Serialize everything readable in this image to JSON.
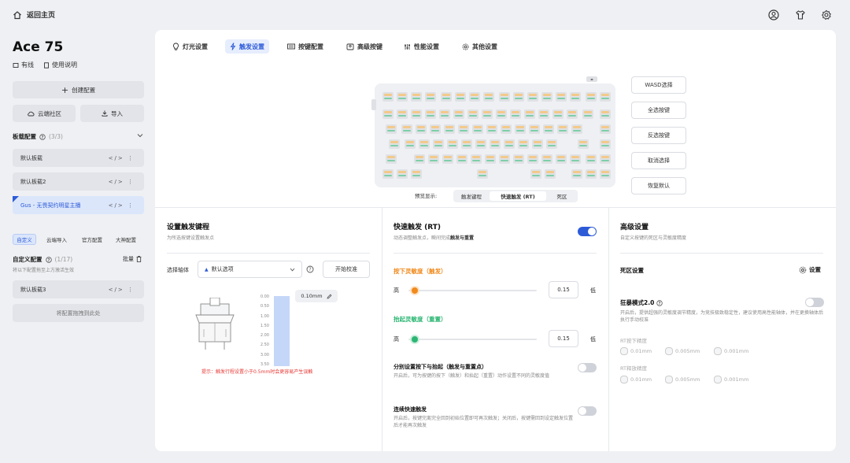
{
  "top": {
    "home_label": "返回主页"
  },
  "sidebar": {
    "device_name": "Ace 75",
    "connection": "有线",
    "manual": "使用说明",
    "create_btn": "创建配置",
    "cloud_btn": "云端社区",
    "import_btn": "导入",
    "boards_title": "板载配置",
    "boards_count": "(3/3)",
    "boards": [
      {
        "label": "默认板载"
      },
      {
        "label": "默认板载2"
      },
      {
        "label": "Gus - 无畏契约明星主播"
      }
    ],
    "filter_tags": [
      "自定义",
      "云端导入",
      "官方配置",
      "大神配置"
    ],
    "custom_title": "自定义配置",
    "custom_count": "(1/17)",
    "batch_label": "批量",
    "custom_hint": "将以下配置拖至上方激活生效",
    "custom_items": [
      {
        "label": "默认板载3"
      }
    ],
    "drop_hint": "将配置拖拽到此处"
  },
  "tabs": [
    {
      "label": "灯光设置",
      "icon": "bulb-icon"
    },
    {
      "label": "触发设置",
      "icon": "lightning-icon"
    },
    {
      "label": "按键配置",
      "icon": "keyboard-icon"
    },
    {
      "label": "高级按键",
      "icon": "user-key-icon"
    },
    {
      "label": "性能设置",
      "icon": "sliders-icon"
    },
    {
      "label": "其他设置",
      "icon": "gear-icon"
    }
  ],
  "active_tab": 1,
  "right_buttons": [
    "WASD选择",
    "全选按键",
    "反选按键",
    "取消选择",
    "恢复默认"
  ],
  "preview": {
    "label": "预览显示:",
    "options": [
      "触发键程",
      "快速触发 (RT)",
      "死区"
    ],
    "selected": 1
  },
  "trigger": {
    "title": "设置触发键程",
    "desc": "为所选按键设置触发点",
    "axis_label": "选择轴体",
    "axis_value": "默认选项",
    "calibrate_btn": "开始校准",
    "value_badge": "0.10mm",
    "y_ticks": [
      "0.00",
      "0.50",
      "1.00",
      "1.50",
      "2.00",
      "2.50",
      "3.00",
      "3.50"
    ],
    "travel_fraction": 1.0,
    "warning": "提示：触发行程设置小于0.5mm时会更容易产生误触"
  },
  "rt": {
    "title": "快速触发 (RT)",
    "desc_a": "动态调整触发点，瞬间完成",
    "desc_b": "触发与重置",
    "enabled": true,
    "press_title": "按下灵敏度（触发）",
    "press_value": "0.15",
    "press_fraction": 0.05,
    "release_title": "抬起灵敏度（重置）",
    "release_value": "0.15",
    "release_fraction": 0.05,
    "high": "高",
    "low": "低",
    "sep_title": "分别设置按下与抬起（触发与重置点）",
    "sep_desc": "开启后，可为按键的按下（触发）和抬起（重置）动作设置不同的灵敏度值",
    "sep_on": false,
    "cont_title": "连续快速触发",
    "cont_desc": "开启后，按键完离完全回到初始位置即可再次触发；关闭后，按键需回到设定触发位置后才能再次触发",
    "cont_on": false
  },
  "advanced": {
    "title": "高级设置",
    "desc": "自定义按键的死区与灵敏度精度",
    "deadzone_title": "死区设置",
    "settings_btn": "设置",
    "mode_title": "狂暴模式2.0",
    "mode_on": false,
    "mode_desc": "开启后，提供超强的灵敏度调节精度，为竞技极致稳定性，建议使用高性能轴体，并在更换轴体后执行手动校准",
    "rt_press_label": "RT按下精度",
    "rt_release_label": "RT释放精度",
    "precision_options": [
      "0.01mm",
      "0.005mm",
      "0.001mm"
    ]
  },
  "colors": {
    "accent": "#2d5bd8",
    "orange": "#f08a1d",
    "green": "#2bb673",
    "warning": "#e53935"
  }
}
